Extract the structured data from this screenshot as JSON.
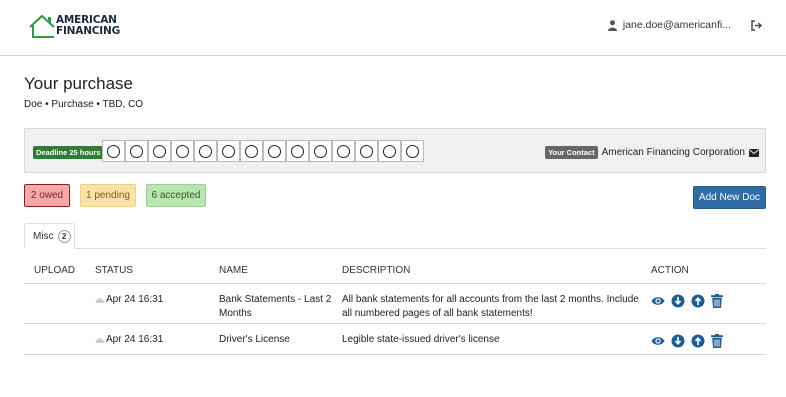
{
  "header": {
    "logo": {
      "line1": "AMERICAN",
      "line2": "FINANCING"
    },
    "user_email": "jane.doe@americanfi...",
    "icons": {
      "user": "user-icon",
      "logout": "sign-out-icon"
    }
  },
  "page": {
    "title": "Your purchase",
    "subtitle": "Doe • Purchase • TBD, CO"
  },
  "deadline_panel": {
    "deadline_label": "Deadline 25 hours",
    "day_count": 14,
    "contact_label": "Your Contact",
    "contact_name": "American Financing Corporation",
    "contact_icon": "envelope-icon"
  },
  "status_badges": {
    "owed": "2 owed",
    "pending": "1 pending",
    "accepted": "6 accepted"
  },
  "add_button": "Add New Doc",
  "tabs": [
    {
      "label": "Misc",
      "count": "2"
    }
  ],
  "table": {
    "headers": {
      "upload": "UPLOAD",
      "status": "STATUS",
      "name": "NAME",
      "description": "DESCRIPTION",
      "action": "ACTION"
    },
    "rows": [
      {
        "status": "Apr 24 16:31",
        "name": "Bank Statements - Last 2 Months",
        "description": "All bank statements for all accounts from the last 2 months. Include all numbered pages of all bank statements!"
      },
      {
        "status": "Apr 24 16:31",
        "name": "Driver's License",
        "description": "Legible state-issued driver's license"
      }
    ],
    "action_icons": [
      "eye-icon",
      "download-icon",
      "upload-icon",
      "trash-icon"
    ]
  },
  "colors": {
    "brand_green": "#2e9e3e",
    "primary_blue": "#2e6da4",
    "icon_blue": "#1f5f99",
    "owed_bg": "#f5a9a9",
    "pending_bg": "#fbe3a8",
    "accepted_bg": "#b8e6b0",
    "deadline_green": "#2e7d32"
  }
}
